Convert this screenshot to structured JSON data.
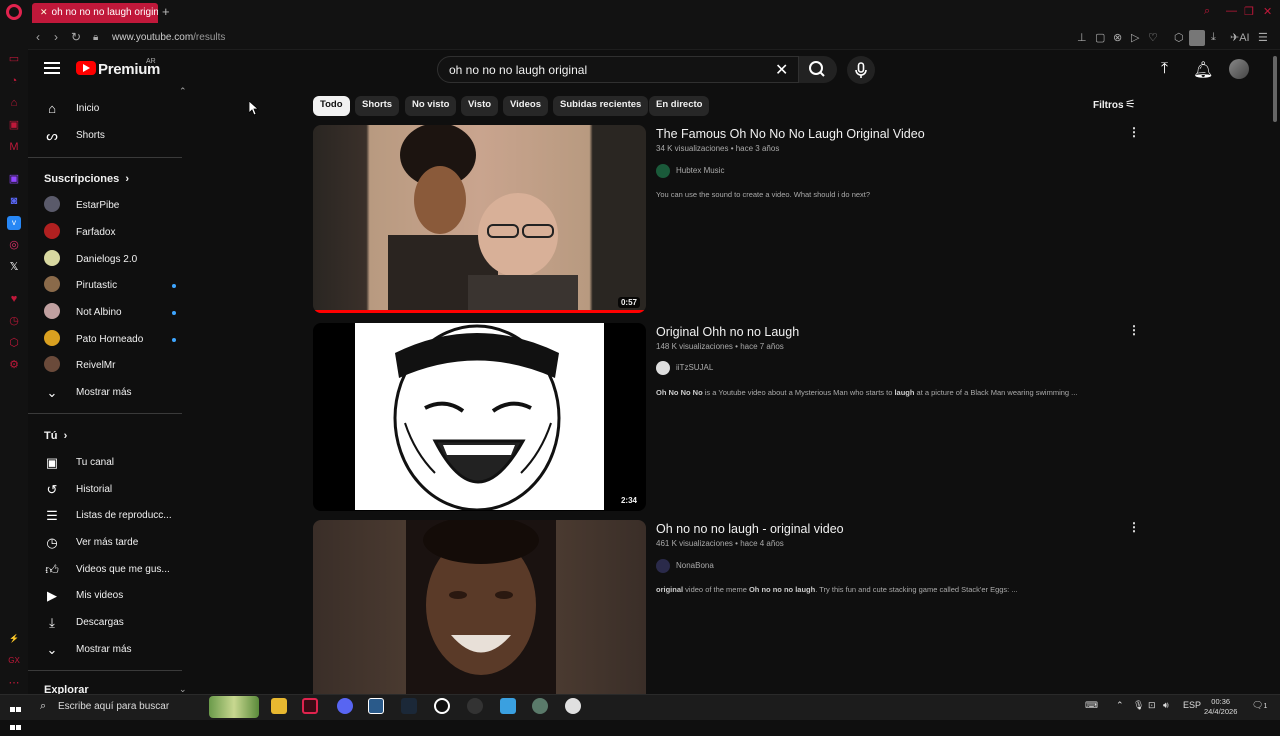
{
  "browser": {
    "tab_title": "oh no no no laugh original",
    "new_tab": "+",
    "url_host": "www.youtube.com",
    "url_path": "/results",
    "ai_label": "AI"
  },
  "header": {
    "logo_text": "Premium",
    "region": "AR",
    "search_value": "oh no no no laugh original"
  },
  "guide": {
    "main": [
      {
        "label": "Inicio",
        "icon": "home-icon"
      },
      {
        "label": "Shorts",
        "icon": "shorts-icon"
      }
    ],
    "subs_header": "Suscripciones",
    "subs": [
      {
        "label": "EstarPibe",
        "color": "#5a5a6a",
        "dot": false
      },
      {
        "label": "Farfadox",
        "color": "#b02020",
        "dot": false
      },
      {
        "label": "Danielogs 2.0",
        "color": "#d8d8a0",
        "dot": false
      },
      {
        "label": "Pirutastic",
        "color": "#8a6a4a",
        "dot": true
      },
      {
        "label": "Not Albino",
        "color": "#c0a0a0",
        "dot": true
      },
      {
        "label": "Pato Horneado",
        "color": "#d9a020",
        "dot": true
      },
      {
        "label": "ReivelMr",
        "color": "#6a4a3a",
        "dot": false
      }
    ],
    "subs_more": "Mostrar más",
    "you_header": "Tú",
    "you": [
      {
        "label": "Tu canal",
        "icon": "user-icon"
      },
      {
        "label": "Historial",
        "icon": "history-icon"
      },
      {
        "label": "Listas de reproducc...",
        "icon": "playlist-icon"
      },
      {
        "label": "Ver más tarde",
        "icon": "clock-icon"
      },
      {
        "label": "Videos que me gus...",
        "icon": "like-icon"
      },
      {
        "label": "Mis videos",
        "icon": "video-icon"
      },
      {
        "label": "Descargas",
        "icon": "download-icon"
      }
    ],
    "you_more": "Mostrar más",
    "explore_header": "Explorar"
  },
  "chips": [
    "Todo",
    "Shorts",
    "No visto",
    "Visto",
    "Videos",
    "Subidas recientes",
    "En directo"
  ],
  "filters_label": "Filtros",
  "results": [
    {
      "title": "The Famous Oh No No No Laugh Original Video",
      "views": "34 K visualizaciones",
      "age": "hace 3 años",
      "channel": "Hubtex Music",
      "channel_color": "#1a5a3a",
      "description": "You can use the sound to create a video. What should i do next?",
      "duration": "0:57",
      "progress": 1.0
    },
    {
      "title": "Original Ohh no no Laugh",
      "views": "148 K visualizaciones",
      "age": "hace 7 años",
      "channel": "iiTzSUJAL",
      "channel_color": "#dddddd",
      "description_pre": "Oh No No No",
      "description_mid": " is a Youtube video about a Mysterious Man who starts to ",
      "description_bold": "laugh",
      "description_post": " at a picture of a Black Man wearing swimming ...",
      "duration": "2:34"
    },
    {
      "title": "Oh no no no laugh - original video",
      "views": "461 K visualizaciones",
      "age": "hace 4 años",
      "channel": "NonaBona",
      "channel_color": "#2a2a4a",
      "description_pre": "original",
      "description_mid": " video of the meme ",
      "description_bold": "Oh no no no laugh",
      "description_post": ". Try this fun and cute stacking game called Stack'er Eggs: ...",
      "duration": ""
    }
  ],
  "taskbar": {
    "search_placeholder": "Escribe aquí para buscar",
    "lang": "ESP",
    "time": "00:36",
    "date": "24/4/2026",
    "notif": "1"
  }
}
